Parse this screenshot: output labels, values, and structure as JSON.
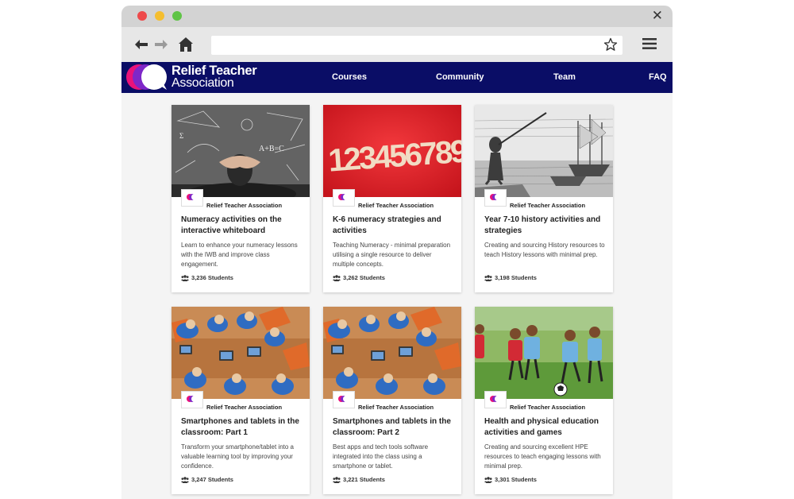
{
  "header": {
    "logo_line1": "Relief Teacher",
    "logo_line2": "Association",
    "nav": [
      "Courses",
      "Community",
      "Team",
      "FAQ"
    ]
  },
  "colors": {
    "header_bg": "#0a0d66",
    "logo_pink": "#e9127a",
    "logo_purple": "#7e27c8"
  },
  "courses": [
    {
      "image": "chalkboard",
      "author": "Relief Teacher Association",
      "title": "Numeracy activities on the interactive whiteboard",
      "description": "Learn to enhance your numeracy lessons with the IWB and improve class engagement.",
      "students": "3,236 Students"
    },
    {
      "image": "numbers",
      "author": "Relief Teacher Association",
      "title": "K-6 numeracy strategies and activities",
      "description": "Teaching Numeracy - minimal preparation utilising a single resource to deliver multiple concepts.",
      "students": "3,262 Students"
    },
    {
      "image": "history-engraving",
      "author": "Relief Teacher Association",
      "title": "Year 7-10 history activities and strategies",
      "description": "Creating and sourcing History resources to teach History lessons with minimal prep.",
      "students": "3,198 Students"
    },
    {
      "image": "classroom-tablets",
      "author": "Relief Teacher Association",
      "title": "Smartphones and tablets in the classroom: Part 1",
      "description": "Transform your smartphone/tablet into a valuable learning tool by improving your confidence.",
      "students": "3,247 Students"
    },
    {
      "image": "classroom-tablets",
      "author": "Relief Teacher Association",
      "title": "Smartphones and tablets in the classroom: Part 2",
      "description": "Best apps and tech tools software integrated into the class using a smartphone or tablet.",
      "students": "3,221 Students"
    },
    {
      "image": "kids-soccer",
      "author": "Relief Teacher Association",
      "title": "Health and physical education activities and games",
      "description": "Creating and sourcing excellent HPE resources to teach engaging lessons with minimal prep.",
      "students": "3,301 Students"
    }
  ]
}
